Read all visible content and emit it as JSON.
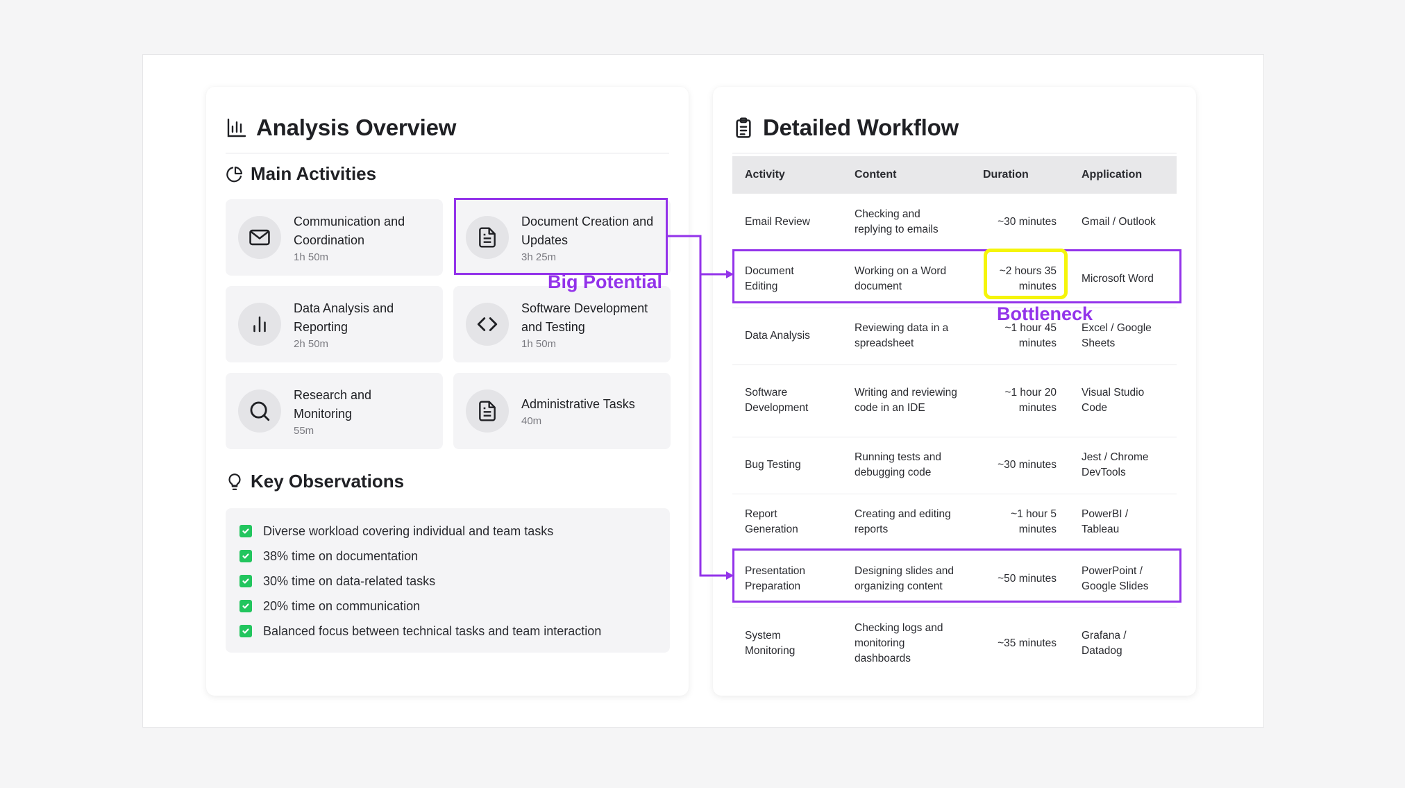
{
  "left_card": {
    "title": "Analysis Overview",
    "main_activities_title": "Main Activities",
    "activities": [
      {
        "label": "Communication and Coordination",
        "time": "1h 50m",
        "icon": "mail-icon"
      },
      {
        "label": "Document Creation and Updates",
        "time": "3h 25m",
        "icon": "document-icon"
      },
      {
        "label": "Data Analysis and Reporting",
        "time": "2h 50m",
        "icon": "bar-chart-icon"
      },
      {
        "label": "Software Development and Testing",
        "time": "1h 50m",
        "icon": "code-icon"
      },
      {
        "label": "Research and Monitoring",
        "time": "55m",
        "icon": "search-icon"
      },
      {
        "label": "Administrative Tasks",
        "time": "40m",
        "icon": "document-icon"
      }
    ],
    "key_observations_title": "Key Observations",
    "observations": [
      "Diverse workload covering individual and team tasks",
      "38% time on documentation",
      "30% time on data-related tasks",
      "20% time on communication",
      "Balanced focus between technical tasks and team interaction"
    ]
  },
  "right_card": {
    "title": "Detailed Workflow",
    "headers": [
      "Activity",
      "Content",
      "Duration",
      "Application"
    ],
    "rows": [
      {
        "activity": "Email Review",
        "content": "Checking and replying to emails",
        "duration": "~30 minutes",
        "application": "Gmail / Outlook"
      },
      {
        "activity": "Document Editing",
        "content": "Working on a Word document",
        "duration": "~2 hours 35 minutes",
        "application": "Microsoft Word"
      },
      {
        "activity": "Data Analysis",
        "content": "Reviewing data in a spreadsheet",
        "duration": "~1 hour 45 minutes",
        "application": "Excel / Google Sheets"
      },
      {
        "activity": "Software Development",
        "content": "Writing and reviewing code in an IDE",
        "duration": "~1 hour 20 minutes",
        "application": "Visual Studio Code"
      },
      {
        "activity": "Bug Testing",
        "content": "Running tests and debugging code",
        "duration": "~30 minutes",
        "application": "Jest / Chrome DevTools"
      },
      {
        "activity": "Report Generation",
        "content": "Creating and editing reports",
        "duration": "~1 hour 5 minutes",
        "application": "PowerBI / Tableau"
      },
      {
        "activity": "Presentation Preparation",
        "content": "Designing slides and organizing content",
        "duration": "~50 minutes",
        "application": "PowerPoint / Google Slides"
      },
      {
        "activity": "System Monitoring",
        "content": "Checking logs and monitoring dashboards",
        "duration": "~35 minutes",
        "application": "Grafana / Datadog"
      }
    ]
  },
  "annotations": {
    "big_potential": "Big Potential",
    "bottleneck": "Bottleneck",
    "purple": "#9333ea",
    "yellow": "#f5f50a"
  },
  "colors": {
    "check_green": "#22c55e",
    "tile_bg": "#f4f4f6"
  }
}
